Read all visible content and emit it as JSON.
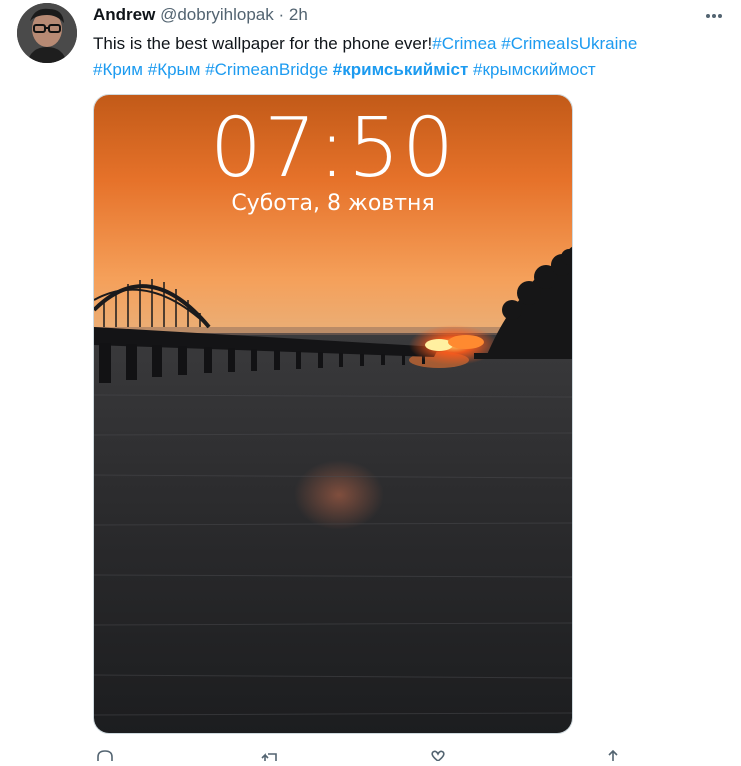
{
  "tweet": {
    "author_name": "Andrew",
    "author_handle": "@dobryihlopak",
    "separator": "·",
    "time": "2h",
    "text": "This is the best wallpaper for the phone ever!",
    "hashtags": [
      "#Crimea",
      "#CrimeaIsUkraine",
      "#Крим",
      "#Крым",
      "#CrimeanBridge",
      "#кримськийміст",
      "#крымскиймост"
    ]
  },
  "wallpaper": {
    "time": "07:50",
    "date": "Субота, 8 жовтня"
  },
  "icons": {
    "more": "more-horizontal-icon",
    "reply": "reply-icon",
    "retweet": "retweet-icon",
    "like": "like-icon",
    "share": "share-icon"
  },
  "colors": {
    "link": "#1d9bf0",
    "secondary_text": "#536471",
    "sky_orange": "#f07a2a",
    "fire": "#ff5a1a"
  }
}
